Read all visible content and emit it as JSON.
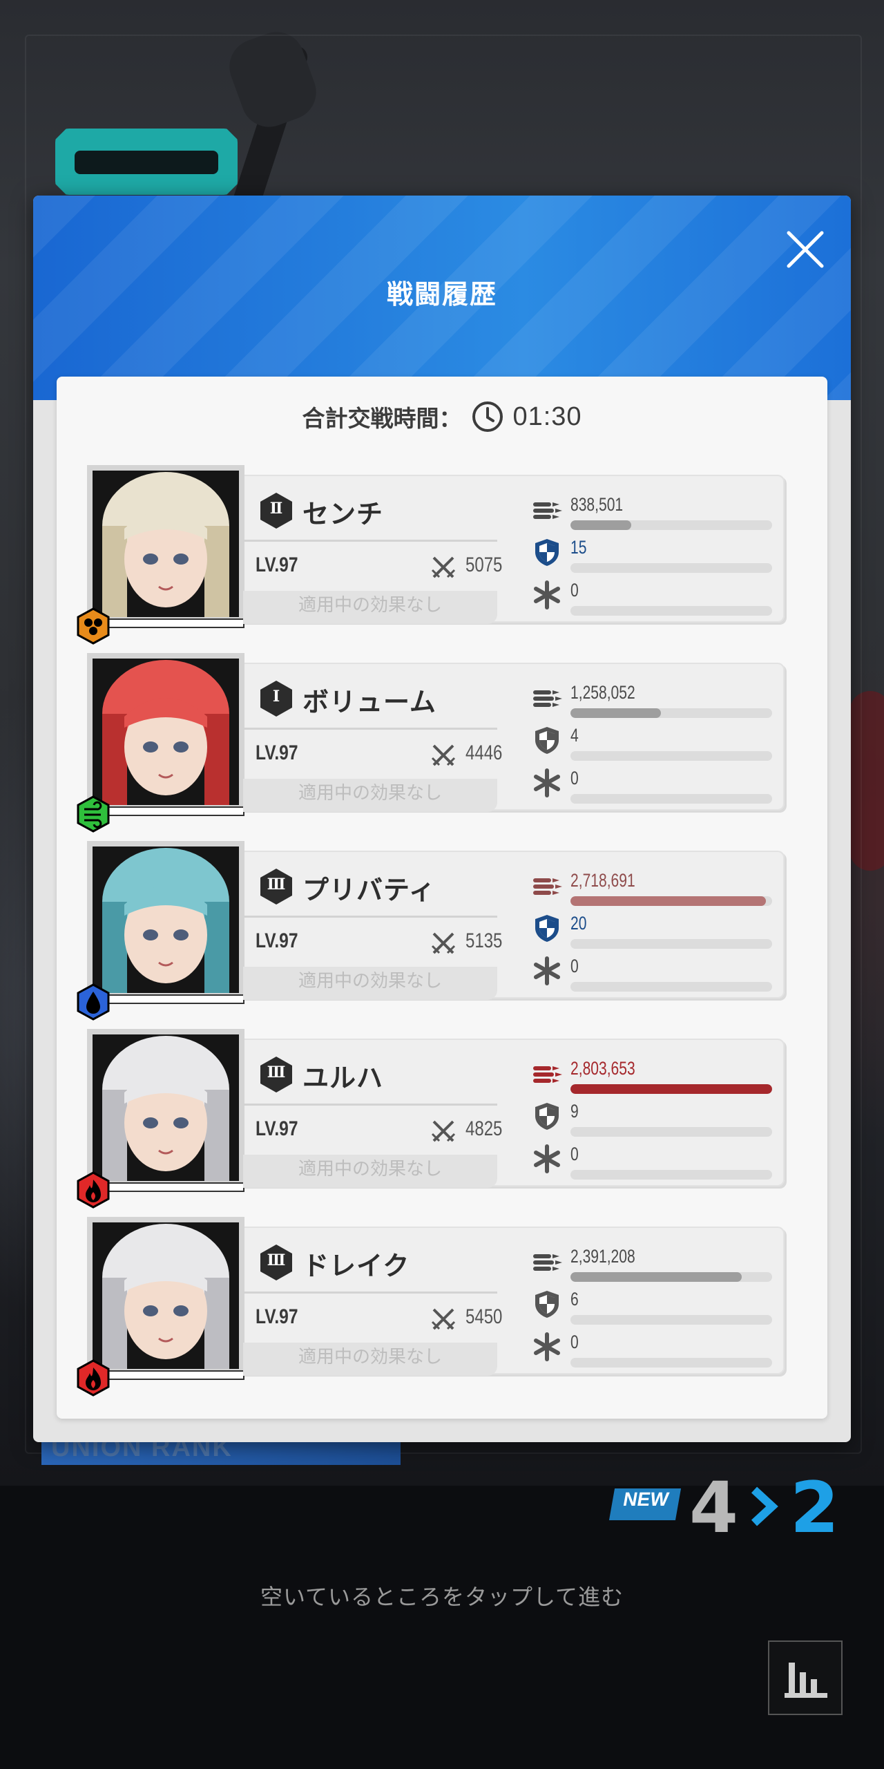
{
  "modal": {
    "title": "戦闘履歴",
    "total_time_label": "合計交戦時間：",
    "total_time_value": "01:30"
  },
  "colors": {
    "header_blue": "#1e7ee0",
    "dps_red": "#a5282c",
    "dps_pink": "#b47474",
    "shield_blue": "#1c4d8a",
    "rank_blue": "#1ea0e6"
  },
  "characters": [
    {
      "name": "センチ",
      "grade": "Ⅱ",
      "level": "LV.97",
      "power": "5075",
      "effect": "適用中の効果なし",
      "element": "iron",
      "damage": "838,501",
      "damage_ratio": 0.3,
      "shield": "15",
      "shield_ratio": 0,
      "heal": "0",
      "heal_ratio": 0
    },
    {
      "name": "ボリューム",
      "grade": "Ⅰ",
      "level": "LV.97",
      "power": "4446",
      "effect": "適用中の効果なし",
      "element": "wind",
      "damage": "1,258,052",
      "damage_ratio": 0.45,
      "shield": "4",
      "shield_ratio": 0,
      "heal": "0",
      "heal_ratio": 0
    },
    {
      "name": "プリバティ",
      "grade": "Ⅲ",
      "level": "LV.97",
      "power": "5135",
      "effect": "適用中の効果なし",
      "element": "water",
      "damage": "2,718,691",
      "damage_ratio": 0.97,
      "shield": "20",
      "shield_ratio": 0,
      "heal": "0",
      "heal_ratio": 0
    },
    {
      "name": "ユルハ",
      "grade": "Ⅲ",
      "level": "LV.97",
      "power": "4825",
      "effect": "適用中の効果なし",
      "element": "fire",
      "damage": "2,803,653",
      "damage_ratio": 1.0,
      "shield": "9",
      "shield_ratio": 0,
      "heal": "0",
      "heal_ratio": 0
    },
    {
      "name": "ドレイク",
      "grade": "Ⅲ",
      "level": "LV.97",
      "power": "5450",
      "effect": "適用中の効果なし",
      "element": "fire",
      "damage": "2,391,208",
      "damage_ratio": 0.85,
      "shield": "6",
      "shield_ratio": 0,
      "heal": "0",
      "heal_ratio": 0
    }
  ],
  "background": {
    "union_rank_text": "UNION RANK"
  },
  "rank": {
    "new_badge": "NEW",
    "old": "4",
    "new": "2"
  },
  "footer": {
    "tap_hint": "空いているところをタップして進む"
  },
  "icons": {
    "close": "close-icon",
    "clock": "clock-icon",
    "damage": "bullets-icon",
    "shield": "shield-icon",
    "heal": "asterisk-icon",
    "power": "crossed-swords-icon",
    "stats": "bar-chart-icon"
  }
}
